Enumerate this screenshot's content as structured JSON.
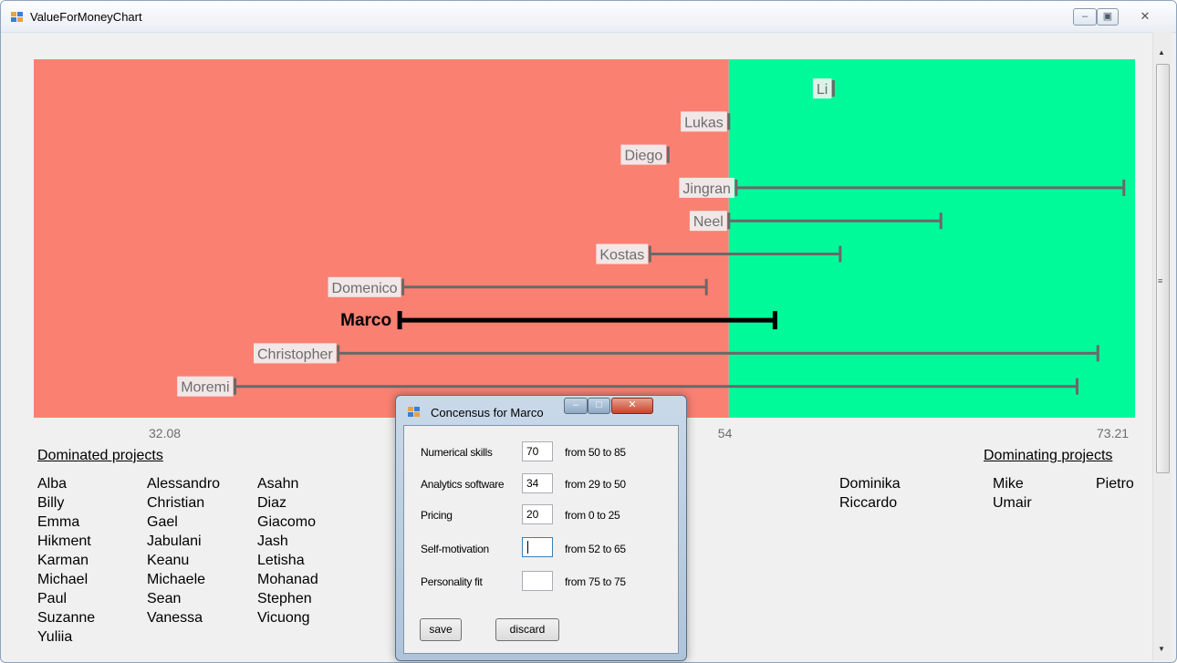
{
  "window": {
    "title": "ValueForMoneyChart"
  },
  "colors": {
    "dominated_zone": "#fa8072",
    "dominating_zone": "#00fa9a",
    "range_bar": "#696969",
    "selected_bar": "#000000"
  },
  "chart_data": {
    "type": "range",
    "x_ticks": [
      "32.08",
      "54",
      "73.21"
    ],
    "x_min": 32.08,
    "x_threshold": 54,
    "x_max": 73.21,
    "x_scale": "log",
    "selected": "Marco",
    "ranges": [
      {
        "name": "Li",
        "from": 58.4,
        "to": 58.4
      },
      {
        "name": "Lukas",
        "from": 54,
        "to": 54
      },
      {
        "name": "Diego",
        "from": 51.6,
        "to": 51.6
      },
      {
        "name": "Jingran",
        "from": 54.3,
        "to": 72.6
      },
      {
        "name": "Neel",
        "from": 54,
        "to": 63.3
      },
      {
        "name": "Kostas",
        "from": 50.9,
        "to": 58.7
      },
      {
        "name": "Domenico",
        "from": 42.3,
        "to": 53.1
      },
      {
        "name": "Marco",
        "from": 42.2,
        "to": 55.9
      },
      {
        "name": "Christopher",
        "from": 40.3,
        "to": 71.2
      },
      {
        "name": "Moremi",
        "from": 37.3,
        "to": 70.1
      }
    ]
  },
  "dominated": {
    "title": "Dominated projects",
    "columns": [
      [
        "Alba",
        "Billy",
        "Emma",
        "Hikment",
        "Karman",
        "Michael",
        "Paul",
        "Suzanne",
        "Yuliia"
      ],
      [
        "Alessandro",
        "Christian",
        "Gael",
        "Jabulani",
        "Keanu",
        "Michaele",
        "Sean",
        "Vanessa"
      ],
      [
        "Asahn",
        "Diaz",
        "Giacomo",
        "Jash",
        "Letisha",
        "Mohanad",
        "Stephen",
        "Vicuong"
      ]
    ]
  },
  "dominating": {
    "title": "Dominating projects",
    "columns": [
      [
        "Dominika",
        "Riccardo"
      ],
      [
        "Mike",
        "Umair"
      ],
      [
        "Pietro"
      ]
    ]
  },
  "dialog": {
    "title": "Concensus for Marco",
    "fields": [
      {
        "label": "Numerical skills",
        "value": "70",
        "range": "from 50 to 85"
      },
      {
        "label": "Analytics software",
        "value": "34",
        "range": "from 29 to 50"
      },
      {
        "label": "Pricing",
        "value": "20",
        "range": "from 0 to 25"
      },
      {
        "label": "Self-motivation",
        "value": "",
        "range": "from 52 to 65"
      },
      {
        "label": "Personality fit",
        "value": "",
        "range": "from 75 to 75"
      }
    ],
    "save_label": "save",
    "discard_label": "discard"
  }
}
